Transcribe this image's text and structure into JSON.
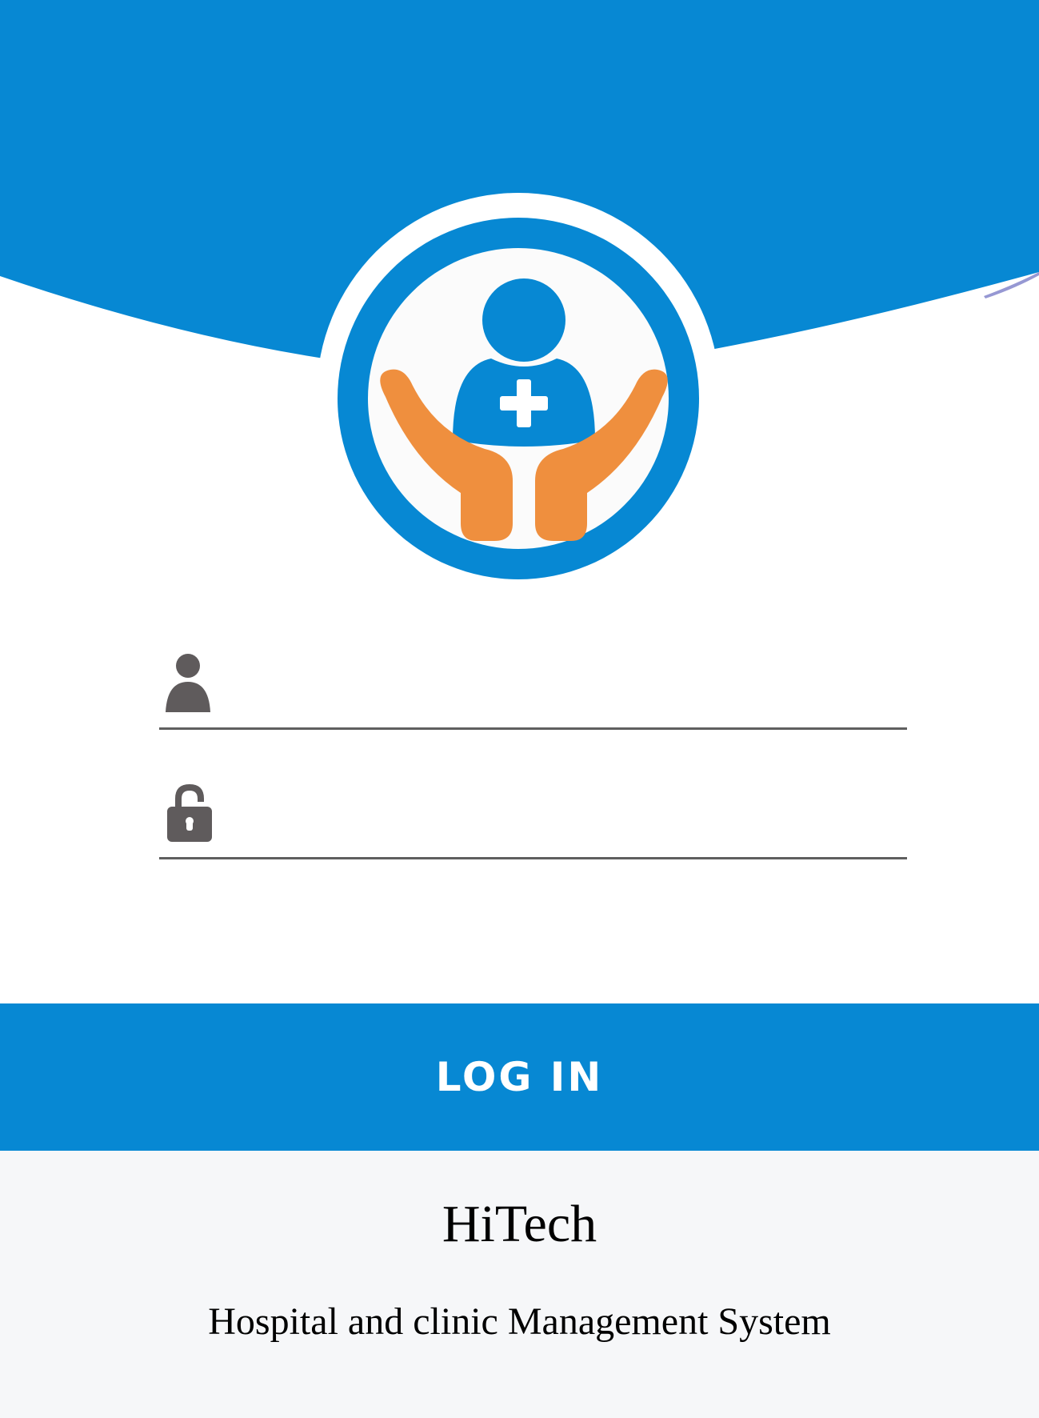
{
  "brand": {
    "primary_color": "#0788d3",
    "accent_color": "#ef8f3e",
    "footer_bg": "#f6f7f9"
  },
  "login_form": {
    "username_icon": "user-icon",
    "password_icon": "lock-icon",
    "username_value": "",
    "password_value": "",
    "submit_label": "LOG IN"
  },
  "footer": {
    "title": "HiTech",
    "subtitle": "Hospital and clinic Management System"
  }
}
